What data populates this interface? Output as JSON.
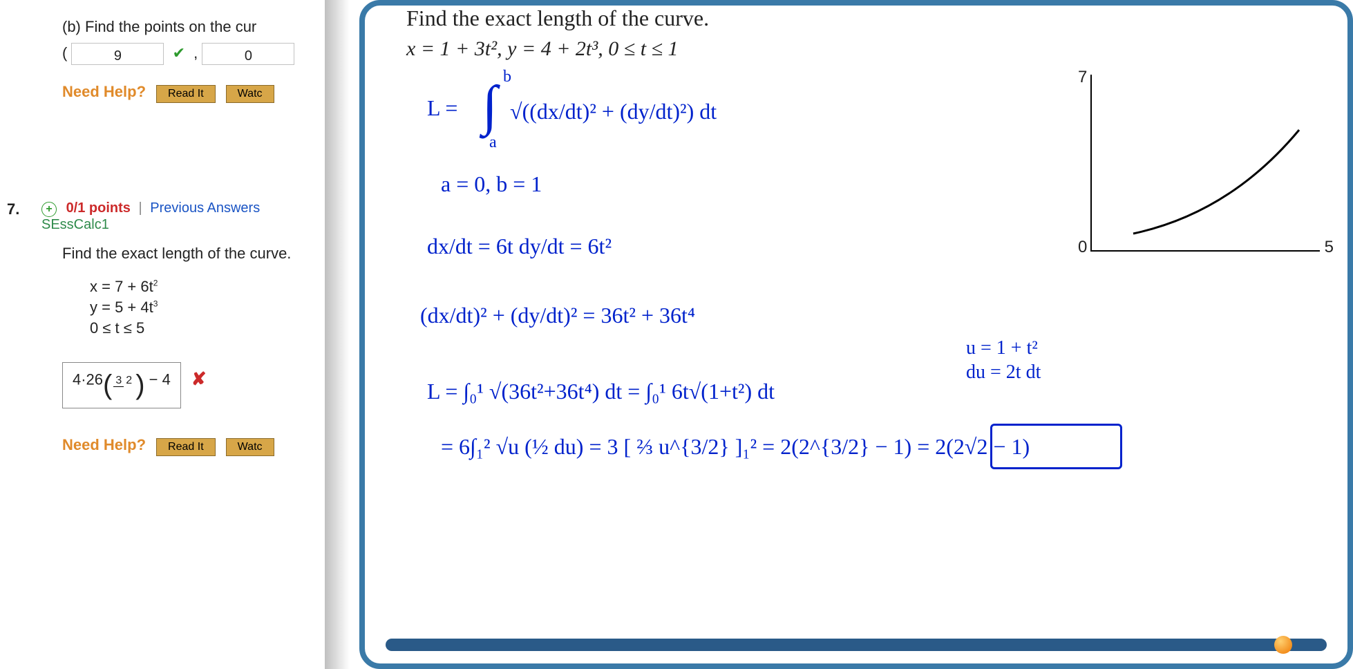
{
  "left": {
    "partb_label": "(b) Find the points on the cur",
    "paren_open": "( ",
    "input1": "9",
    "comma": " , ",
    "input2": "0",
    "need_help": "Need Help?",
    "read_it": "Read It",
    "watch": "Watc",
    "q_number": "7.",
    "score": "0/1 points",
    "prev_answers": "Previous Answers",
    "source": "SEssCalc1",
    "prompt": "Find the exact length of the curve.",
    "eq_x": "x = 7 + 6t",
    "eq_x_exp": "2",
    "eq_y": "y = 5 + 4t",
    "eq_y_exp": "3",
    "eq_range": "0 ≤ t ≤ 5",
    "answer_a": "4·26",
    "answer_frac_num": "3",
    "answer_frac_den": "2",
    "answer_b": " − 4"
  },
  "right": {
    "title": "Find the exact length of the curve.",
    "given": "x = 1 + 3t²,   y = 4 + 2t³,   0 ≤ t ≤ 1",
    "axis_x": "5",
    "axis_o": "0",
    "axis_top": "7",
    "work": {
      "l1a": "L =",
      "l1b": "∫",
      "l1_lim_b": "b",
      "l1_lim_a": "a",
      "l1c": "√((dx/dt)² + (dy/dt)²) dt",
      "l2": "a = 0,  b = 1",
      "l3": "dx/dt = 6t     dy/dt = 6t²",
      "l4": "(dx/dt)² + (dy/dt)² = 36t² + 36t⁴",
      "l5a": "L = ∫₀¹ √(36t²+36t⁴) dt = ∫₀¹ 6t√(1+t²) dt",
      "l5b": "u = 1 + t²",
      "l5c": "du = 2t dt",
      "l6": "= 6∫₁² √u (½ du) = 3 [ ⅔ u^{3/2} ]₁²  = 2(2^{3/2} − 1) = 2(2√2 − 1)"
    }
  }
}
